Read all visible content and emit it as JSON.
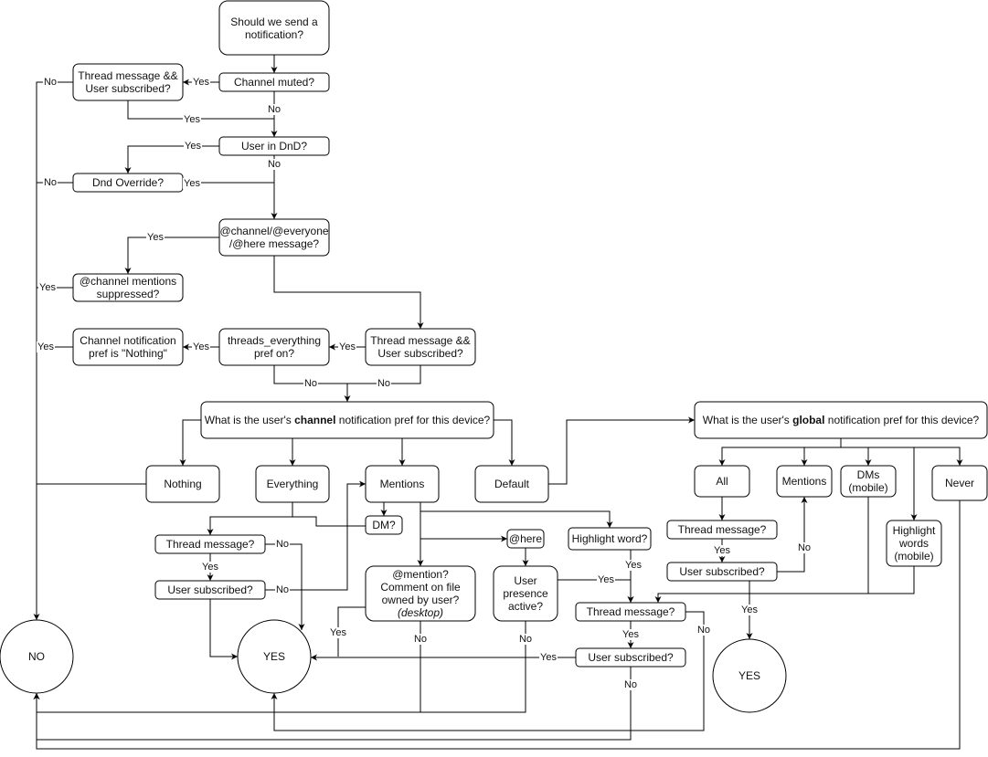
{
  "diagram": {
    "title": "Should we send a notification?",
    "nodes": {
      "start": "Should we send a notification?",
      "channel_muted": "Channel muted?",
      "thread_sub_1": "Thread message && User subscribed?",
      "user_dnd": "User in DnD?",
      "dnd_override": "Dnd Override?",
      "channel_everyone": "@channel/@everyone /@here message?",
      "channel_mentions_suppressed": "@channel mentions suppressed?",
      "thread_sub_2": "Thread message && User subscribed?",
      "threads_everything": "threads_everything pref on?",
      "channel_pref_nothing": "Channel notification pref is \"Nothing\"",
      "channel_pref_q_pre": "What is the user's ",
      "channel_pref_q_bold": "channel",
      "channel_pref_q_post": " notification pref for this device?",
      "opt_nothing": "Nothing",
      "opt_everything": "Everything",
      "opt_mentions": "Mentions",
      "opt_default": "Default",
      "dm": "DM?",
      "thread_msg_a": "Thread message?",
      "user_sub_a": "User subscribed?",
      "mention_q_line1": "@mention?",
      "mention_q_line2": "Comment on file owned by user?",
      "mention_q_line3": "(desktop)",
      "here": "@here",
      "user_presence": "User presence active?",
      "highlight_word": "Highlight word?",
      "thread_msg_b": "Thread message?",
      "user_sub_b": "User subscribed?",
      "global_pref_q_pre": "What is the user's ",
      "global_pref_q_bold": "global",
      "global_pref_q_post": " notification pref for this device?",
      "g_all": "All",
      "g_mentions": "Mentions",
      "g_dms": "DMs (mobile)",
      "g_never": "Never",
      "g_highlight": "Highlight words (mobile)",
      "thread_msg_c": "Thread message?",
      "user_sub_c": "User subscribed?",
      "result_no": "NO",
      "result_yes_1": "YES",
      "result_yes_2": "YES"
    },
    "edge_labels": {
      "yes": "Yes",
      "no": "No"
    }
  }
}
